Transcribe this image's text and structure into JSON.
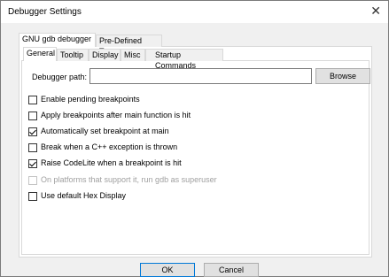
{
  "dialog": {
    "title": "Debugger Settings",
    "close_glyph": "✕"
  },
  "outer_tabs": [
    {
      "label": "GNU gdb debugger"
    },
    {
      "label": "Pre-Defined Types"
    }
  ],
  "inner_tabs": [
    {
      "label": "General"
    },
    {
      "label": "Tooltip"
    },
    {
      "label": "Display"
    },
    {
      "label": "Misc"
    },
    {
      "label": "Startup Commands"
    }
  ],
  "general": {
    "debugger_path_label": "Debugger path:",
    "debugger_path_value": "",
    "browse_label": "Browse",
    "options": [
      {
        "label": "Enable pending breakpoints",
        "checked": false,
        "enabled": true
      },
      {
        "label": "Apply breakpoints after main function is hit",
        "checked": false,
        "enabled": true
      },
      {
        "label": "Automatically set breakpoint at main",
        "checked": true,
        "enabled": true
      },
      {
        "label": "Break when a C++ exception is thrown",
        "checked": false,
        "enabled": true
      },
      {
        "label": "Raise CodeLite when a breakpoint is hit",
        "checked": true,
        "enabled": true
      },
      {
        "label": "On platforms that support it, run gdb as superuser",
        "checked": false,
        "enabled": false
      },
      {
        "label": "Use default Hex Display",
        "checked": false,
        "enabled": true
      }
    ]
  },
  "buttons": {
    "ok_label": "OK",
    "cancel_label": "Cancel"
  },
  "colors": {
    "accent": "#0078d7",
    "disabled_text": "#a0a0a0"
  }
}
